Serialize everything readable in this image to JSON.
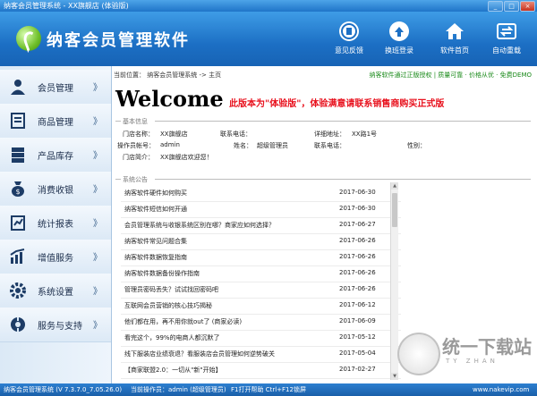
{
  "window": {
    "title": "纳客会员管理系统 - XX旗舰店 (体验版)",
    "minimize_glyph": "_",
    "maximize_glyph": "□",
    "close_glyph": "×"
  },
  "header": {
    "app_title": "纳客会员管理软件",
    "toolbar": [
      {
        "label": "意见反馈",
        "icon": "feedback-icon"
      },
      {
        "label": "换班登录",
        "icon": "switch-user-icon"
      },
      {
        "label": "软件首页",
        "icon": "home-icon"
      },
      {
        "label": "自动重载",
        "icon": "reload-icon"
      }
    ]
  },
  "sidebar": {
    "chevron": "》",
    "items": [
      {
        "label": "会员管理",
        "icon": "member-icon"
      },
      {
        "label": "商品管理",
        "icon": "product-icon"
      },
      {
        "label": "产品库存",
        "icon": "inventory-icon"
      },
      {
        "label": "消费收银",
        "icon": "cashier-icon"
      },
      {
        "label": "统计报表",
        "icon": "report-icon"
      },
      {
        "label": "增值服务",
        "icon": "value-added-icon"
      },
      {
        "label": "系统设置",
        "icon": "settings-icon"
      },
      {
        "label": "服务与支持",
        "icon": "support-icon"
      }
    ]
  },
  "main": {
    "breadcrumb": "当前位置： 纳客会员管理系统 -> 主页",
    "notice": "纳客软件通过正版授权 | 质量可靠 · 价格从优 · 免费DEMO",
    "welcome": "Welcome",
    "trial_notice": "此版本为\"体验版\"，体验满意请联系销售商购买正式版",
    "basic_info": {
      "heading": "基本信息",
      "store_name_label": "门店名称：",
      "store_name": "XX旗舰店",
      "phone_label": "联系电话：",
      "phone": "",
      "address_label": "详细地址：",
      "address": "XX路1号",
      "operator_label": "操作员帐号：",
      "operator": "admin",
      "name_label": "姓名：",
      "name": "超级管理员",
      "contact_label": "联系电话：",
      "contact": "",
      "gender_label": "性别：",
      "gender": "",
      "intro_label": "门店简介：",
      "intro": "XX旗舰店欢迎您！"
    },
    "announcements": {
      "heading": "系统公告",
      "items": [
        {
          "title": "纳客软件硬件如何购买",
          "date": "2017-06-30"
        },
        {
          "title": "纳客软件短信如何开通",
          "date": "2017-06-30"
        },
        {
          "title": "会员管理系统与收银系统区别在哪？商家应如何选择？",
          "date": "2017-06-27"
        },
        {
          "title": "纳客软件常见问题合集",
          "date": "2017-06-26"
        },
        {
          "title": "纳客软件数据恢复指南",
          "date": "2017-06-26"
        },
        {
          "title": "纳客软件数据备份操作指南",
          "date": "2017-06-26"
        },
        {
          "title": "管理员密码丢失？试试找回密码吧",
          "date": "2017-06-26"
        },
        {
          "title": "互联网会员营销的核心技巧揭秘",
          "date": "2017-06-12"
        },
        {
          "title": "他们都在用，再不用你就out了 (商家必读)",
          "date": "2017-06-09"
        },
        {
          "title": "看完这个，99%的电商人都沉默了",
          "date": "2017-05-12"
        },
        {
          "title": "线下服装店业绩衰退？看服装店会员管理如何逆势破关",
          "date": "2017-05-04"
        },
        {
          "title": "【商家联盟2.0：一切从\"新\"开始】",
          "date": "2017-02-27"
        }
      ]
    }
  },
  "status_bar": {
    "version": "纳客会员管理系统 (V 7.3.7.0_7.05.26.0)",
    "operator": "当前操作员：admin (超级管理员)",
    "shortcuts": "F1打开帮助 Ctrl+F12锁屏",
    "website": "www.nakevip.com"
  },
  "watermark": {
    "text": "统一下载站",
    "sub": "TY ZHAN"
  },
  "colors": {
    "header_blue": "#1c6fc4",
    "sidebar_bg": "#dbe9f6",
    "trial_red": "#e8121e",
    "notice_green": "#1a8a1a"
  }
}
